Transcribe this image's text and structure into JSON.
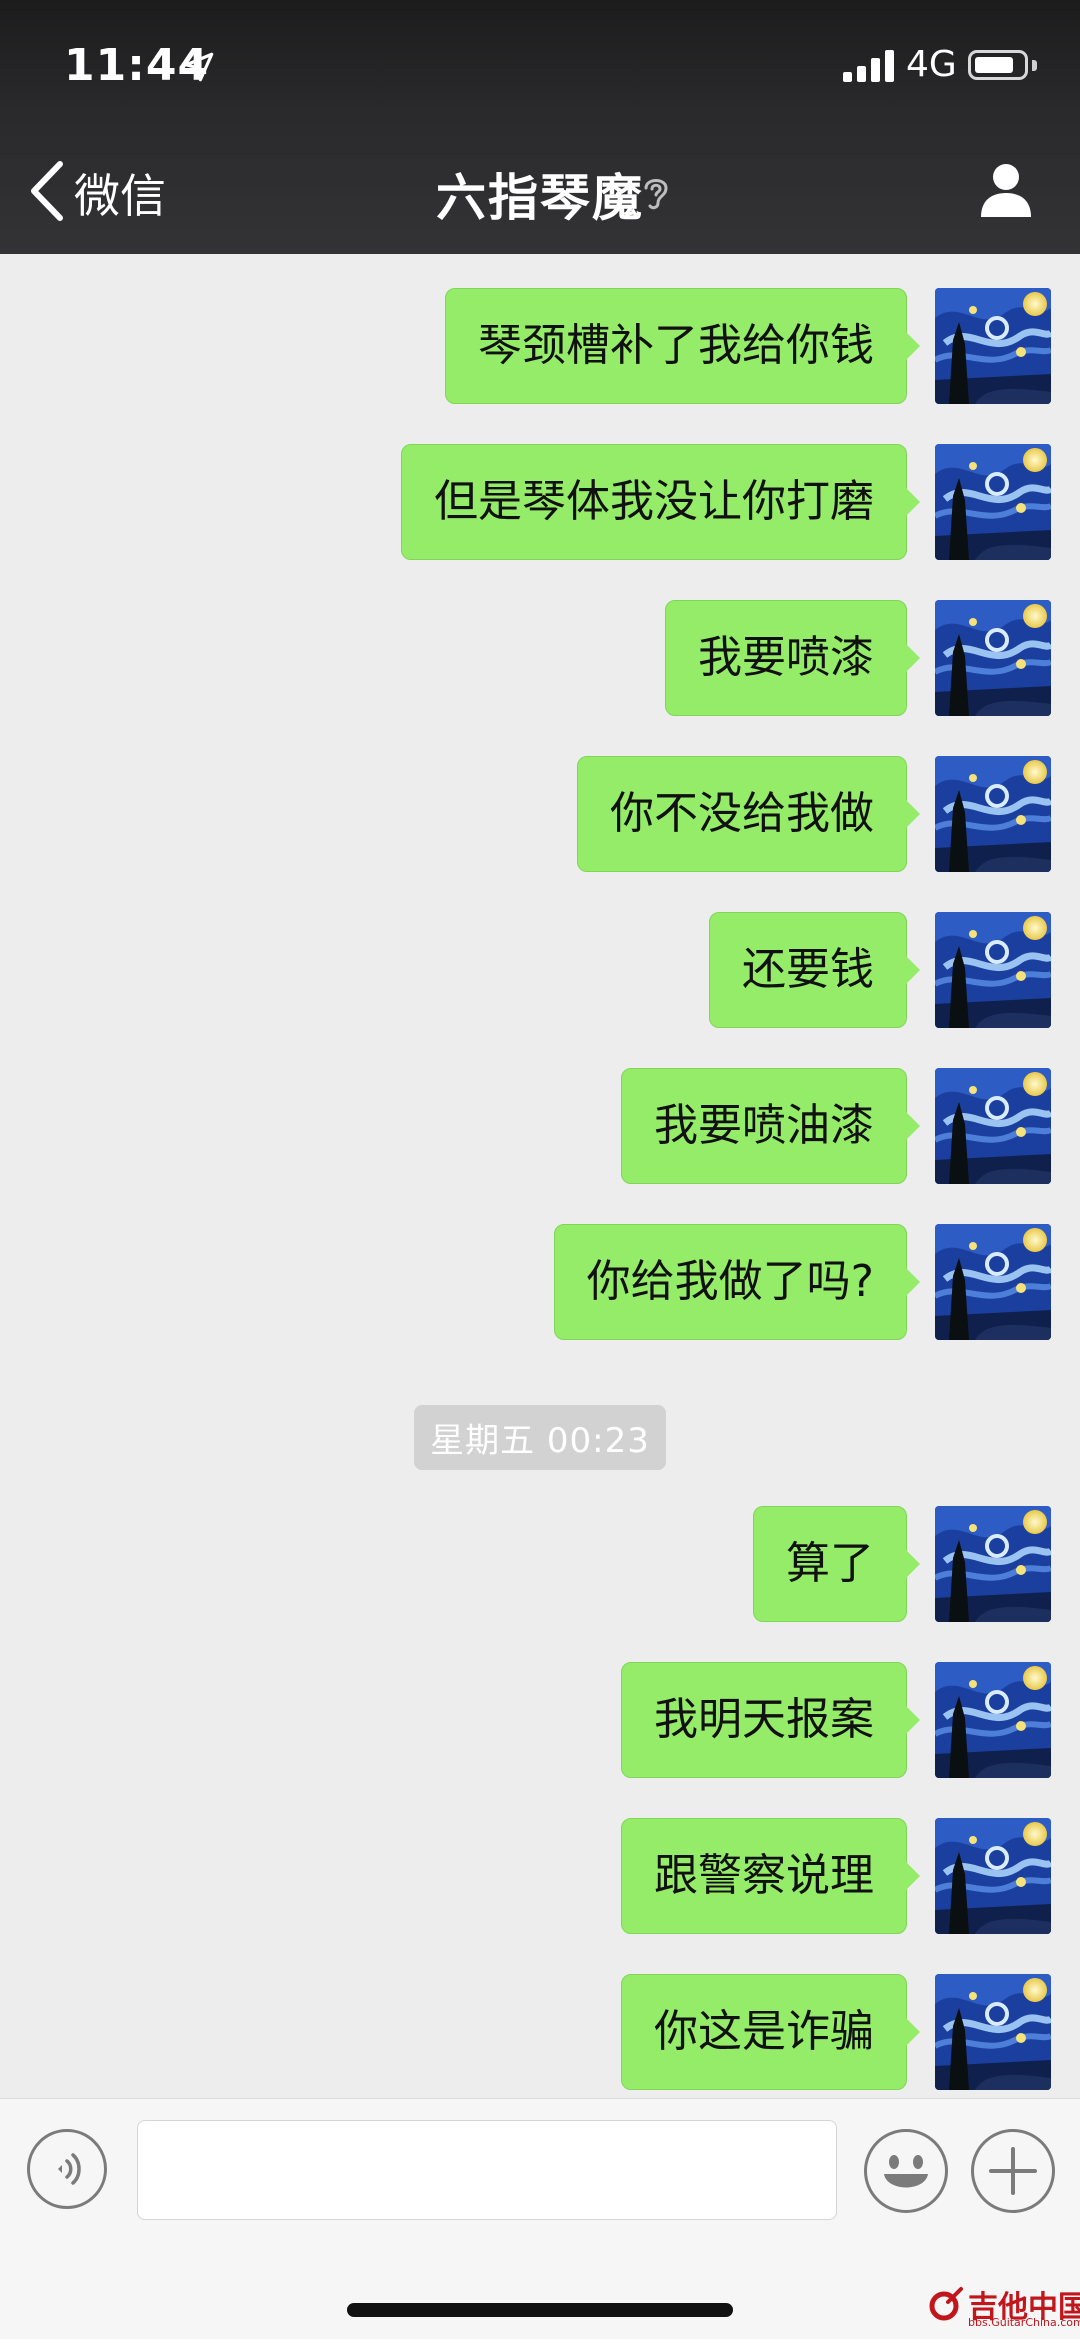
{
  "status_bar": {
    "time": "11:44",
    "network": "4G",
    "icons": [
      "location-arrow-icon",
      "signal-bars-icon",
      "battery-icon"
    ]
  },
  "nav_bar": {
    "back_label": "微信",
    "title": "六指琴魔",
    "title_icon": "ear-icon",
    "right_icon": "profile-icon"
  },
  "messages": [
    {
      "text": "琴颈槽补了我给你钱"
    },
    {
      "text": "但是琴体我没让你打磨"
    },
    {
      "text": "我要喷漆"
    },
    {
      "text": "你不没给我做"
    },
    {
      "text": "还要钱"
    },
    {
      "text": "我要喷油漆"
    },
    {
      "text": "你给我做了吗?"
    },
    {
      "text": "算了"
    },
    {
      "text": "我明天报案"
    },
    {
      "text": "跟警察说理"
    },
    {
      "text": "你这是诈骗"
    }
  ],
  "timestamp": "星期五 00:23",
  "input_bar": {
    "value": "",
    "icons": [
      "voice-icon",
      "emoji-icon",
      "plus-icon"
    ]
  },
  "watermark": {
    "text": "吉他中国",
    "sub": "bbs.GuitarChina.com"
  },
  "colors": {
    "bubble": "#95ec69",
    "background": "#ededed",
    "header": "#2a2a2c"
  }
}
